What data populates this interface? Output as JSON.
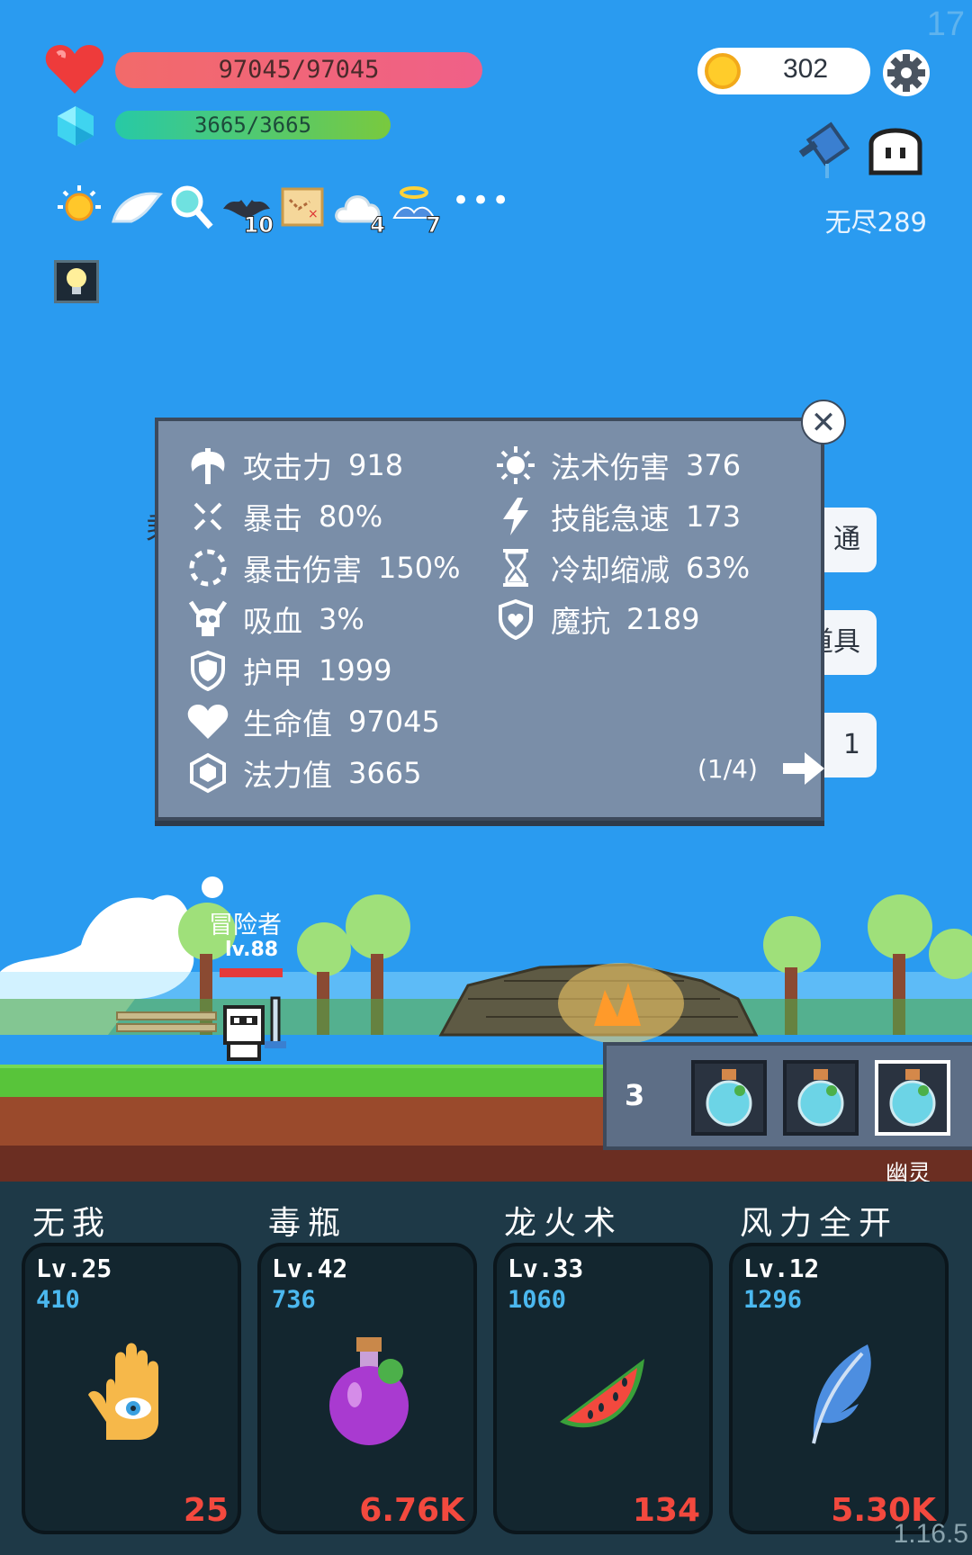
{
  "hud": {
    "fps": "17",
    "hp_text": "97045/97045",
    "mp_text": "3665/3665",
    "coins": "302",
    "endless_label": "无尽289"
  },
  "buffs": [
    {
      "icon": "sun-icon",
      "count": ""
    },
    {
      "icon": "wing-icon",
      "count": ""
    },
    {
      "icon": "magnifier-icon",
      "count": ""
    },
    {
      "icon": "bat-icon",
      "count": "10"
    },
    {
      "icon": "map-icon",
      "count": ""
    },
    {
      "icon": "cloud-icon",
      "count": "4"
    },
    {
      "icon": "angel-icon",
      "count": "7"
    }
  ],
  "side_buttons": [
    "通",
    "道具",
    "1"
  ],
  "stats_panel": {
    "left": [
      {
        "icon": "axe-icon",
        "label": "攻击力",
        "value": "918"
      },
      {
        "icon": "crit-icon",
        "label": "暴击",
        "value": "80%"
      },
      {
        "icon": "crit-damage-icon",
        "label": "暴击伤害",
        "value": "150%"
      },
      {
        "icon": "skull-icon",
        "label": "吸血",
        "value": "3%"
      },
      {
        "icon": "shield-icon",
        "label": "护甲",
        "value": "1999"
      },
      {
        "icon": "heart-icon",
        "label": "生命值",
        "value": "97045"
      },
      {
        "icon": "gem-icon",
        "label": "法力值",
        "value": "3665"
      }
    ],
    "right": [
      {
        "icon": "spell-sun-icon",
        "label": "法术伤害",
        "value": "376"
      },
      {
        "icon": "lightning-icon",
        "label": "技能急速",
        "value": "173"
      },
      {
        "icon": "hourglass-icon",
        "label": "冷却缩减",
        "value": "63%"
      },
      {
        "icon": "magic-shield-icon",
        "label": "魔抗",
        "value": "2189"
      }
    ],
    "pager": "(1/4)"
  },
  "scene": {
    "hero_name": "冒险者",
    "hero_level": "lv.88",
    "enemy_count": "3",
    "enemy_name": "幽灵"
  },
  "skills": [
    {
      "name": "无我",
      "level": "Lv.25",
      "cost": "410",
      "damage": "25",
      "icon": "eye-hand-icon"
    },
    {
      "name": "毒瓶",
      "level": "Lv.42",
      "cost": "736",
      "damage": "6.76K",
      "icon": "poison-bottle-icon"
    },
    {
      "name": "龙火术",
      "level": "Lv.33",
      "cost": "1060",
      "damage": "134",
      "icon": "watermelon-icon"
    },
    {
      "name": "风力全开",
      "level": "Lv.12",
      "cost": "1296",
      "damage": "5.30K",
      "icon": "feather-icon"
    }
  ],
  "version": "1.16.5",
  "colors": {
    "sky": "#2a9bf0",
    "panel": "#7a8ea8",
    "bottom_bar": "#1e3947",
    "damage": "#f3493e",
    "cost": "#4bb8ef"
  }
}
